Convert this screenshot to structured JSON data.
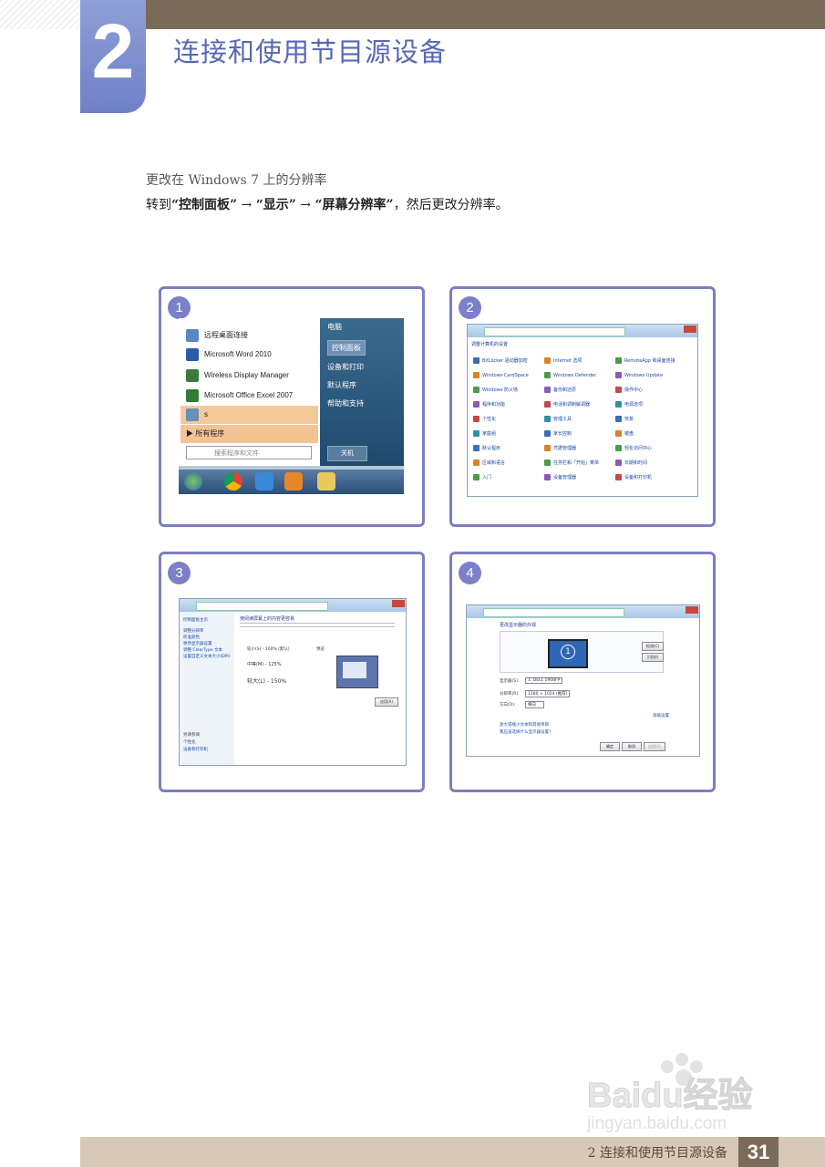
{
  "header": {
    "chapter_number": "2",
    "chapter_title": "连接和使用节目源设备"
  },
  "intro": {
    "title": "更改在 Windows 7 上的分辨率",
    "line_prefix": "转到",
    "control_panel": "“控制面板”",
    "arrow": " → ",
    "display": "“显示”",
    "screen_res": "“屏幕分辨率”",
    "line_suffix": "，然后更改分辨率。"
  },
  "panels": [
    {
      "badge": "1"
    },
    {
      "badge": "2"
    },
    {
      "badge": "3"
    },
    {
      "badge": "4"
    }
  ],
  "start_menu": {
    "items": [
      "远程桌面连接",
      "Microsoft Word 2010",
      "Wireless Display Manager",
      "Microsoft Office Excel 2007",
      "s"
    ],
    "all_programs": "所有程序",
    "search_placeholder": "搜索程序和文件",
    "right_items": [
      "电脑",
      "控制面板",
      "设备和打印",
      "默认程序",
      "帮助和支持"
    ],
    "shutdown": "关机"
  },
  "control_panel": {
    "heading": "调整计算机的设置",
    "items": [
      [
        "BitLocker 驱动器加密",
        "Internet 选项",
        "RemoteApp 和桌面连接"
      ],
      [
        "Windows CardSpace",
        "Windows Defender",
        "Windows Update"
      ],
      [
        "Windows 防火墙",
        "备份和还原",
        "操作中心"
      ],
      [
        "程序和功能",
        "电话和调制解调器",
        "电源选项"
      ],
      [
        "个性化",
        "管理工具",
        "恢复"
      ],
      [
        "家庭组",
        "家长控制",
        "键盘"
      ],
      [
        "默认程序",
        "凭据管理器",
        "轻松访问中心"
      ],
      [
        "区域和语言",
        "任务栏和「开始」菜单",
        "日期和时间"
      ],
      [
        "入门",
        "设备管理器",
        "设备和打印机"
      ]
    ]
  },
  "display_window": {
    "title": "使阅读屏幕上的内容更容易",
    "options": [
      "较小(S) - 100% (默认)",
      "中等(M) - 125%",
      "较大(L) - 150%"
    ],
    "preview_label": "预览",
    "apply": "应用(A)",
    "sidebar": [
      "控制面板主页",
      "调整分辨率",
      "校准颜色",
      "更改显示器设置",
      "调整 ClearType 文本",
      "设置自定义文本大小(DPI)"
    ],
    "see_also": [
      "另请参阅",
      "个性化",
      "设备和打印机"
    ]
  },
  "resolution_window": {
    "title": "更改显示器的外观",
    "detect": "检测(C)",
    "identify": "识别(I)",
    "monitor_id": "1",
    "fields": [
      {
        "label": "显示器(S):",
        "value": "1. DELL 1908FP"
      },
      {
        "label": "分辨率(R):",
        "value": "1280 × 1024 (推荐)"
      },
      {
        "label": "方向(O):",
        "value": "横向"
      }
    ],
    "advanced": "高级设置",
    "links": [
      "放大或缩小文本和其他项目",
      "我应该选择什么显示器设置?"
    ],
    "buttons": [
      "确定",
      "取消",
      "应用(A)"
    ]
  },
  "footer": {
    "chapter": "2 连接和使用节目源设备",
    "page": "31"
  },
  "watermark": {
    "logo": "Baidu经验",
    "url": "jingyan.baidu.com"
  }
}
